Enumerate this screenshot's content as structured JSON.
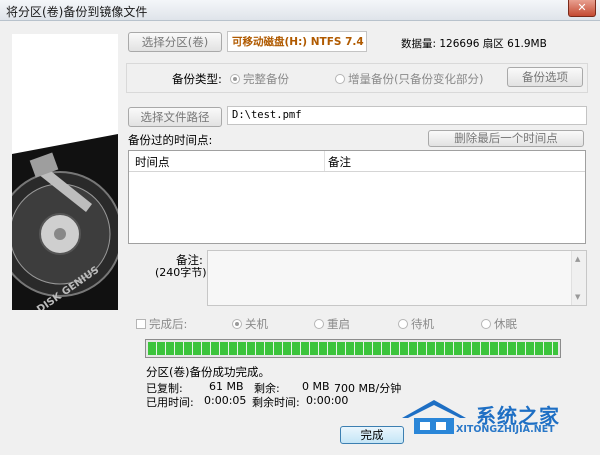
{
  "window": {
    "title": "将分区(卷)备份到镜像文件",
    "close_label": "✕"
  },
  "top": {
    "select_partition_label": "选择分区(卷)",
    "partition_value": "可移动磁盘(H:) NTFS 7.4",
    "data_size": "数据量: 126696 扇区  61.9MB"
  },
  "backup": {
    "type_label": "备份类型:",
    "full_label": "完整备份",
    "incremental_label": "增量备份(只备份变化部分)",
    "options_label": "备份选项"
  },
  "file": {
    "select_path_label": "选择文件路径",
    "path_value": "D:\\test.pmf"
  },
  "timepoints": {
    "label": "备份过的时间点:",
    "delete_last_label": "删除最后一个时间点",
    "columns": [
      "时间点",
      "备注"
    ]
  },
  "note": {
    "label": "备注:",
    "sublabel": "(240字节)"
  },
  "after": {
    "checkbox_label": "完成后:",
    "options": [
      "关机",
      "重启",
      "待机",
      "休眠"
    ],
    "selected": "关机"
  },
  "progress": {
    "value": 1.0
  },
  "status": {
    "message": "分区(卷)备份成功完成。",
    "copied_label": "已复制:",
    "copied_value": "61 MB",
    "remaining_label": "剩余:",
    "remaining_value": "0 MB",
    "speed_value": "700 MB/分钟",
    "elapsed_label": "已用时间:",
    "elapsed_value": "0:00:05",
    "time_left_label": "剩余时间:",
    "time_left_value": "0:00:00"
  },
  "done_label": "完成",
  "side_image_text": "DISK GENIUS",
  "watermark": {
    "text": "系统之家",
    "url": "XITONGZHIJIA.NET"
  },
  "colors": {
    "progress_green": "#3cc43c",
    "watermark_blue": "#1e6fc4"
  }
}
